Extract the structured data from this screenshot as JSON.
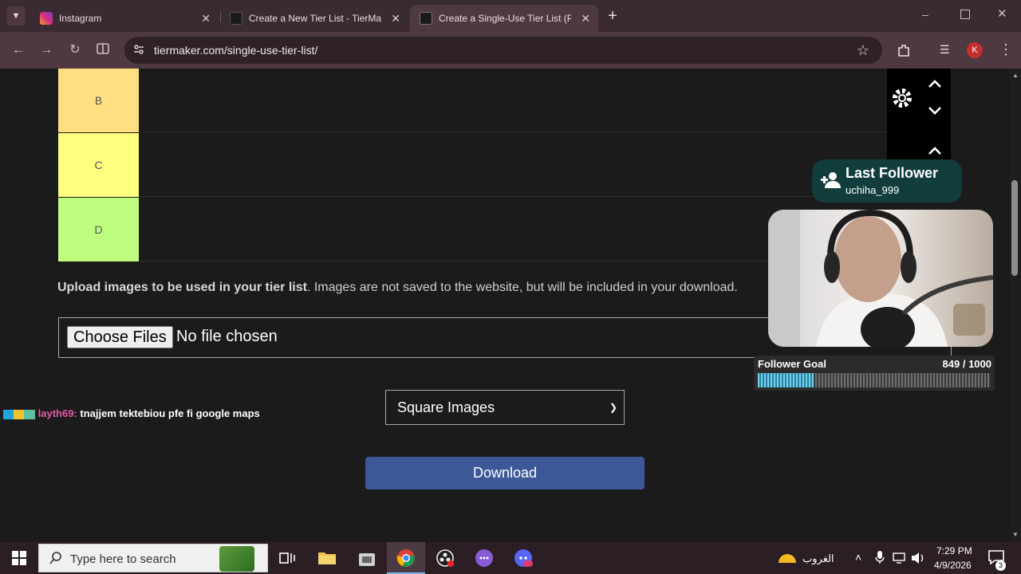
{
  "browser": {
    "tabs": [
      {
        "title": "Instagram",
        "active": false
      },
      {
        "title": "Create a New Tier List - TierMaker",
        "active": false
      },
      {
        "title": "Create a Single-Use Tier List (Print",
        "active": true
      }
    ],
    "url": "tiermaker.com/single-use-tier-list/",
    "profile_initial": "K"
  },
  "tiers": [
    {
      "label": "B",
      "color": "#ffdf80"
    },
    {
      "label": "C",
      "color": "#ffff7f"
    },
    {
      "label": "D",
      "color": "#bfff7f"
    }
  ],
  "upload": {
    "bold_text": "Upload images to be used in your tier list",
    "rest_text": ". Images are not saved to the website, but will be included in your download.",
    "choose_label": "Choose Files",
    "no_file_label": "No file chosen"
  },
  "image_shape_select": {
    "selected": "Square Images"
  },
  "download_label": "Download",
  "overlay": {
    "last_follower_title": "Last Follower",
    "last_follower_name": "uchiha_999",
    "goal_label": "Follower Goal",
    "goal_count": "849 / 1000",
    "goal_progress": 0.849,
    "chat_user": "layth69:",
    "chat_text": "tnajjem tektebiou pfe fi google maps"
  },
  "taskbar": {
    "search_placeholder": "Type here to search",
    "weather_text": "الغروب",
    "time": "7:29 PM",
    "date": "4/9/2026",
    "notification_count": "3"
  }
}
